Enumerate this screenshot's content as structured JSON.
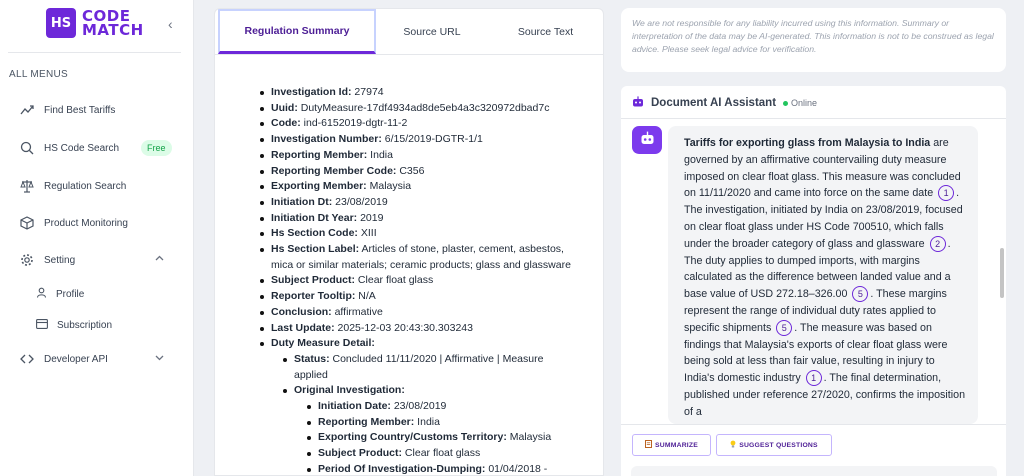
{
  "brand": {
    "mark": "HS",
    "line1": "CODE",
    "line2": "MATCH",
    "accent": "#6d28d9"
  },
  "sidebar": {
    "collapse_glyph": "‹",
    "heading": "ALL MENUS",
    "items": [
      {
        "label": "Find Best Tariffs",
        "icon": "trend-icon"
      },
      {
        "label": "HS Code Search",
        "icon": "search-icon",
        "badge": "Free"
      },
      {
        "label": "Regulation Search",
        "icon": "scale-icon"
      },
      {
        "label": "Product Monitoring",
        "icon": "box-icon"
      },
      {
        "label": "Setting",
        "icon": "gear-icon",
        "expanded": true
      },
      {
        "label": "Developer API",
        "icon": "code-icon",
        "expanded": false
      }
    ],
    "sub_items": [
      {
        "label": "Profile",
        "icon": "user-icon"
      },
      {
        "label": "Subscription",
        "icon": "card-icon"
      }
    ]
  },
  "tabs": [
    {
      "label": "Regulation Summary",
      "active": true
    },
    {
      "label": "Source URL",
      "active": false
    },
    {
      "label": "Source Text",
      "active": false
    }
  ],
  "summary": {
    "items": [
      {
        "key": "Investigation Id:",
        "value": " 27974"
      },
      {
        "key": "Uuid:",
        "value": " DutyMeasure-17df4934ad8de5eb4a3c320972dbad7c"
      },
      {
        "key": "Code:",
        "value": " ind-6152019-dgtr-11-2"
      },
      {
        "key": "Investigation Number:",
        "value": " 6/15/2019-DGTR-1/1"
      },
      {
        "key": "Reporting Member:",
        "value": " India"
      },
      {
        "key": "Reporting Member Code:",
        "value": " C356"
      },
      {
        "key": "Exporting Member:",
        "value": " Malaysia"
      },
      {
        "key": "Initiation Dt:",
        "value": " 23/08/2019"
      },
      {
        "key": "Initiation Dt Year:",
        "value": " 2019"
      },
      {
        "key": "Hs Section Code:",
        "value": " XIII"
      },
      {
        "key": "Hs Section Label:",
        "value": " Articles of stone, plaster, cement, asbestos, mica or similar materials; ceramic products; glass and glassware"
      },
      {
        "key": "Subject Product:",
        "value": " Clear float glass"
      },
      {
        "key": "Reporter Tooltip:",
        "value": " N/A"
      },
      {
        "key": "Conclusion:",
        "value": " affirmative"
      },
      {
        "key": "Last Update:",
        "value": " 2025-12-03 20:43:30.303243"
      },
      {
        "key": "Duty Measure Detail:",
        "value": ""
      }
    ],
    "status": {
      "key": "Status:",
      "value": " Concluded 11/11/2020 | Affirmative | Measure applied"
    },
    "original": {
      "key": "Original Investigation:",
      "value": ""
    },
    "original_items": [
      {
        "key": "Initiation Date:",
        "value": " 23/08/2019"
      },
      {
        "key": "Reporting Member:",
        "value": " India"
      },
      {
        "key": "Exporting Country/Customs Territory:",
        "value": " Malaysia"
      },
      {
        "key": "Subject Product:",
        "value": " Clear float glass"
      },
      {
        "key": "Period Of Investigation-Dumping:",
        "value": " 01/04/2018 -"
      }
    ]
  },
  "disclaimer": "We are not responsible for any liability incurred using this information. Summary or interpretation of the data may be AI-generated. This information is not to be construed as legal advice. Please seek legal advice for verification.",
  "assistant": {
    "title": "Document AI Assistant",
    "status": "Online",
    "message": {
      "heading": "Tariffs for exporting glass from Malaysia to India",
      "p1": " are governed by an affirmative countervailing duty measure imposed on clear float glass. This measure was concluded on 11/11/2020 and came into force on the same date ",
      "c1": "1",
      "p2": ". The investigation, initiated by India on 23/08/2019, focused on clear float glass under HS Code 700510, which falls under the broader category of glass and glassware ",
      "c2": "2",
      "p3": ". The duty applies to dumped imports, with margins calculated as the difference between landed value and a base value of USD 272.18–326.00 ",
      "c3": "5",
      "p4": ". These margins represent the range of individual duty rates applied to specific shipments ",
      "c4": "5",
      "p5": ". The measure was based on findings that Malaysia's exports of clear float glass were being sold at less than fair value, resulting in injury to India's domestic industry ",
      "c5": "1",
      "p6": ". The final determination, published under reference 27/2020, confirms the imposition of a"
    },
    "actions": {
      "summarize": "SUMMARIZE",
      "suggest": "SUGGEST QUESTIONS"
    }
  }
}
